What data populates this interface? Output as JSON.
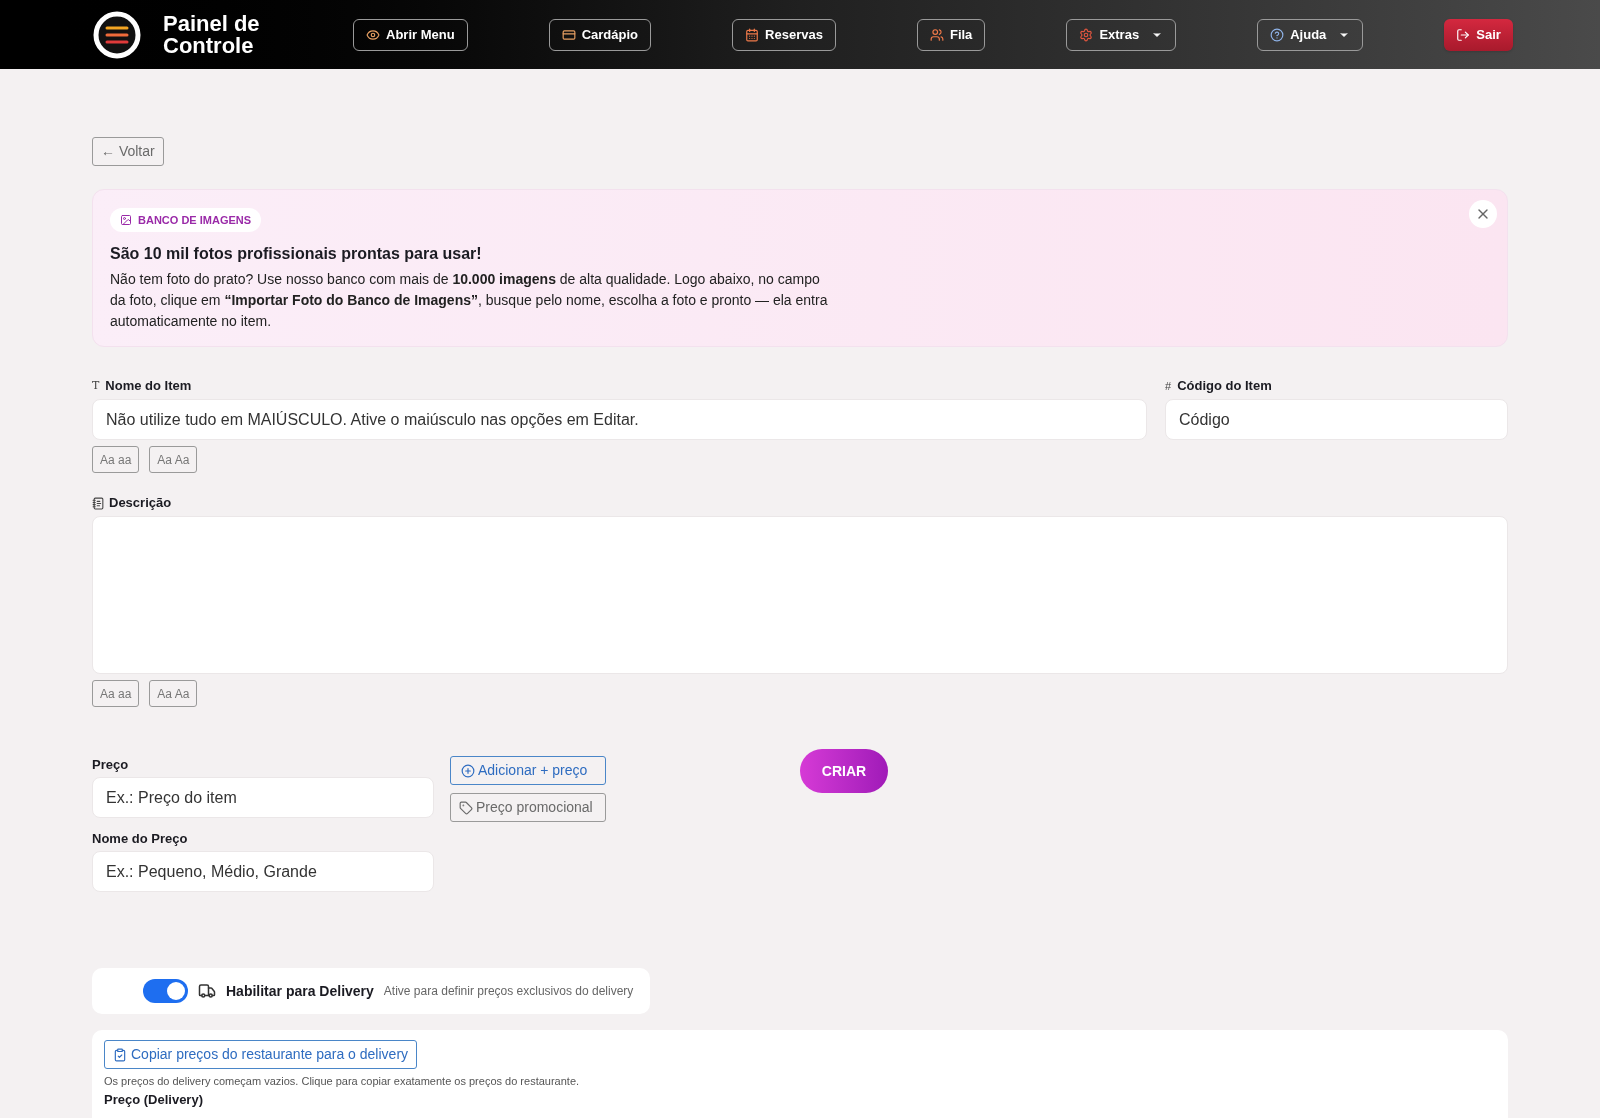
{
  "header": {
    "brand": [
      "Painel de",
      "Controle"
    ],
    "nav": [
      {
        "label": "Abrir Menu",
        "dropdown": false,
        "kind": "outline"
      },
      {
        "label": "Cardápio",
        "dropdown": false,
        "kind": "outline"
      },
      {
        "label": "Reservas",
        "dropdown": false,
        "kind": "outline"
      },
      {
        "label": "Fila",
        "dropdown": false,
        "kind": "outline"
      },
      {
        "label": "Extras",
        "dropdown": true,
        "kind": "outline"
      },
      {
        "label": "Ajuda",
        "dropdown": true,
        "kind": "outline"
      },
      {
        "label": "Sair",
        "dropdown": false,
        "kind": "danger"
      }
    ]
  },
  "back_button": "← Voltar",
  "banner": {
    "badge": "BANCO DE IMAGENS",
    "title": "São 10 mil fotos profissionais prontas para usar!",
    "text": "Não tem foto do prato? Use nosso banco com mais de **10.000 imagens** de alta qualidade. Logo abaixo, no campo da foto, clique em **“Importar Foto do Banco de Imagens”**, busque pelo nome, escolha a foto e pronto — ela entra automaticamente no item."
  },
  "item_name": {
    "icon": "T",
    "label": "Nome do Item",
    "placeholder": "Não utilize tudo em MAIÚSCULO. Ative o maiúsculo nas opções em Editar.",
    "case_buttons": [
      "Aa aa",
      "Aa Aa"
    ]
  },
  "item_code": {
    "icon": "#",
    "label": "Código do Item",
    "placeholder": "Código"
  },
  "description": {
    "label": "Descrição",
    "case_buttons": [
      "Aa aa",
      "Aa Aa"
    ]
  },
  "price": {
    "label": "Preço",
    "placeholder": "Ex.: Preço do item"
  },
  "price_name": {
    "label": "Nome do Preço",
    "placeholder": "Ex.: Pequeno, Médio, Grande"
  },
  "add_price_button": "Adicionar + preço",
  "promo_price_button": "Preço promocional",
  "create_button": "CRIAR",
  "delivery": {
    "on": true,
    "label": "Habilitar para Delivery",
    "hint": "Ative para definir preços exclusivos do delivery"
  },
  "delivery_prices": {
    "copy_button": "Copiar preços do restaurante para o delivery",
    "help": "Os preços do delivery começam vazios. Clique para copiar exatamente os preços do restaurante.",
    "price_label": "Preço (Delivery)"
  }
}
